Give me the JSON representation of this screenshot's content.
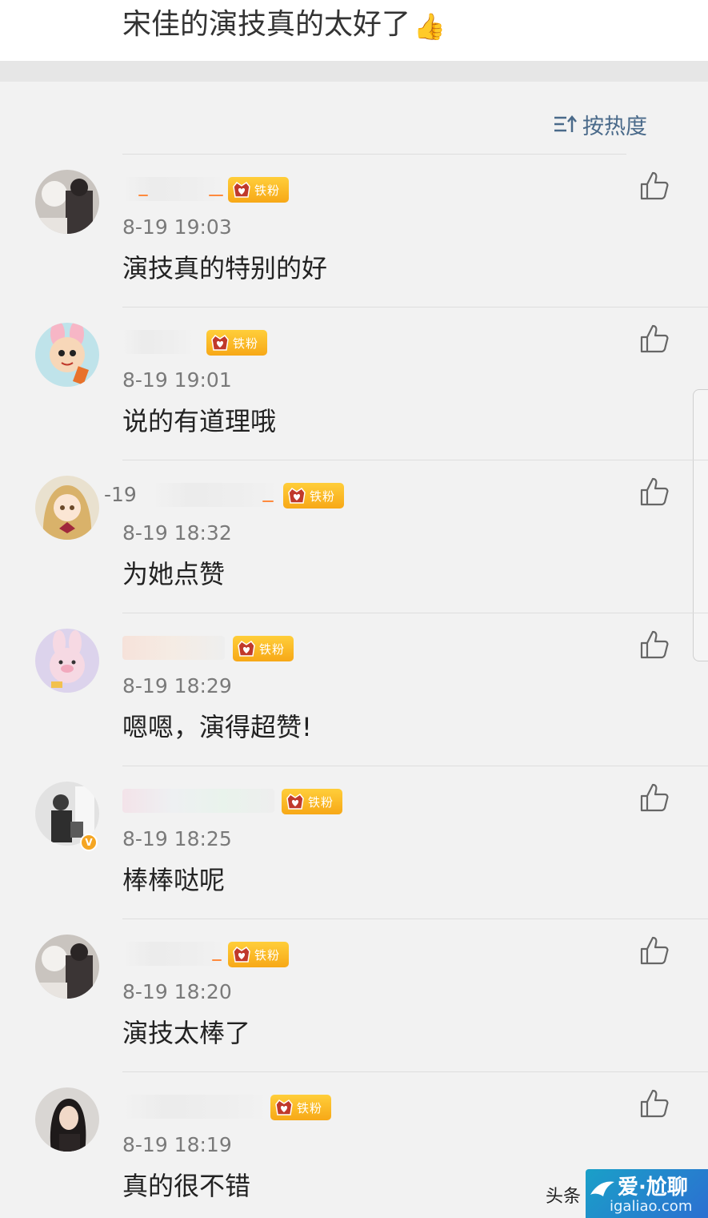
{
  "post": {
    "title": "宋佳的演技真的太好了",
    "title_emoji": "👍"
  },
  "sort": {
    "label": "按热度"
  },
  "fan_badge_label": "铁粉",
  "colors": {
    "badge": "#f7a817",
    "sort_text": "#4a6a8a",
    "background": "#f2f2f2"
  },
  "comments": [
    {
      "time": "8-19 19:03",
      "text": "演技真的特别的好",
      "avatar_icon": "avatar-bear-icon"
    },
    {
      "time": "8-19 19:01",
      "text": "说的有道理哦",
      "avatar_icon": "avatar-cartoon-icon"
    },
    {
      "time": "8-19 18:32",
      "text": "为她点赞",
      "avatar_icon": "avatar-anime-girl-icon",
      "name_fragment": "-19"
    },
    {
      "time": "8-19 18:29",
      "text": "嗯嗯，演得超赞!",
      "avatar_icon": "avatar-bunny-icon"
    },
    {
      "time": "8-19 18:25",
      "text": "棒棒哒呢",
      "avatar_icon": "avatar-photo-icon",
      "verified": "V"
    },
    {
      "time": "8-19 18:20",
      "text": "演技太棒了",
      "avatar_icon": "avatar-bear-icon"
    },
    {
      "time": "8-19 18:19",
      "text": "真的很不错",
      "avatar_icon": "avatar-woman-icon"
    }
  ],
  "watermark": {
    "source": "头条",
    "logo_text": "爱·尬聊",
    "logo_url": "igaliao.com"
  }
}
